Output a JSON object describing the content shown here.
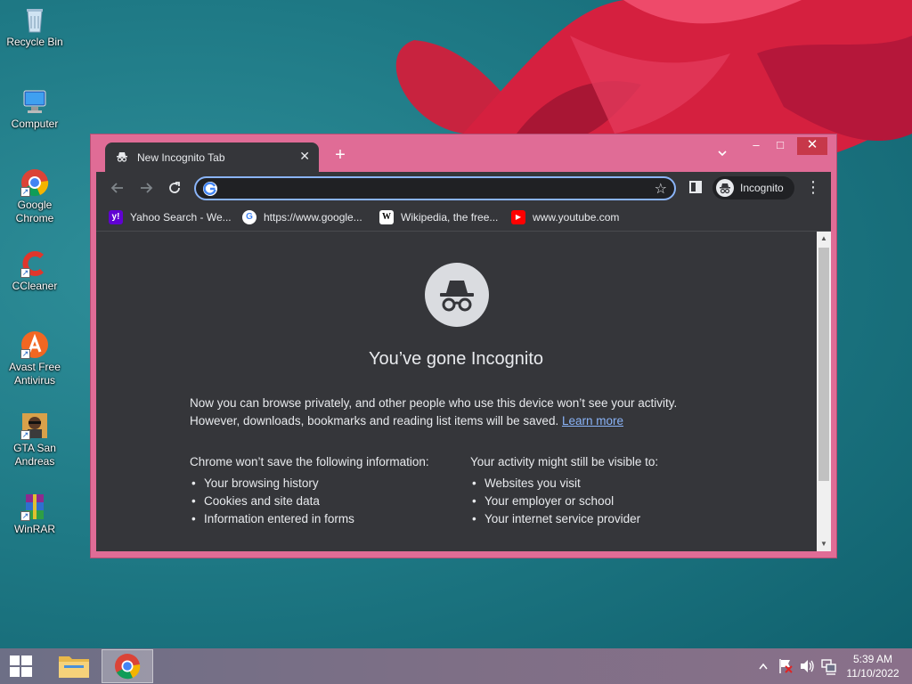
{
  "desktop": {
    "icons": [
      {
        "label": "Recycle Bin",
        "icon": "recycle-bin-icon"
      },
      {
        "label": "Computer",
        "icon": "computer-icon"
      },
      {
        "label": "Google Chrome",
        "icon": "chrome-icon"
      },
      {
        "label": "CCleaner",
        "icon": "ccleaner-icon"
      },
      {
        "label": "Avast Free Antivirus",
        "icon": "avast-icon"
      },
      {
        "label": "GTA San Andreas",
        "icon": "gta-icon"
      },
      {
        "label": "WinRAR",
        "icon": "winrar-icon"
      }
    ]
  },
  "browser": {
    "tab": {
      "title": "New Incognito Tab",
      "close": "✕"
    },
    "new_tab": "+",
    "window_controls": {
      "minimize": "–",
      "maximize": "□",
      "close": "✕"
    },
    "omnibox": {
      "value": "",
      "placeholder": ""
    },
    "profile_label": "Incognito",
    "bookmarks": [
      {
        "label": "Yahoo Search - We...",
        "icon": "yahoo-icon",
        "color": "#6001d2",
        "glyph": "y!"
      },
      {
        "label": "https://www.google...",
        "icon": "google-icon",
        "color": "#ffffff",
        "glyph": "G"
      },
      {
        "label": "Wikipedia, the free...",
        "icon": "wikipedia-icon",
        "color": "#ffffff",
        "glyph": "W"
      },
      {
        "label": "www.youtube.com",
        "icon": "youtube-icon",
        "color": "#ff0000",
        "glyph": "▶"
      }
    ],
    "page": {
      "headline": "You’ve gone Incognito",
      "para1": "Now you can browse privately, and other people who use this device won’t see your activity. However, downloads, bookmarks and reading list items will be saved.",
      "learn_more": "Learn more",
      "left_heading": "Chrome won’t save the following information:",
      "left_items": [
        "Your browsing history",
        "Cookies and site data",
        "Information entered in forms"
      ],
      "right_heading": "Your activity might still be visible to:",
      "right_items": [
        "Websites you visit",
        "Your employer or school",
        "Your internet service provider"
      ]
    }
  },
  "taskbar": {
    "clock_time": "5:39 AM",
    "clock_date": "11/10/2022",
    "tray_icons": [
      "show-hidden-icons",
      "action-center-flag-icon",
      "volume-icon",
      "network-icon"
    ]
  },
  "colors": {
    "window_frame": "#e06c96",
    "chrome_dark": "#35363a",
    "omnibox_focus": "#8ab4f8",
    "link": "#8ab4f8"
  }
}
